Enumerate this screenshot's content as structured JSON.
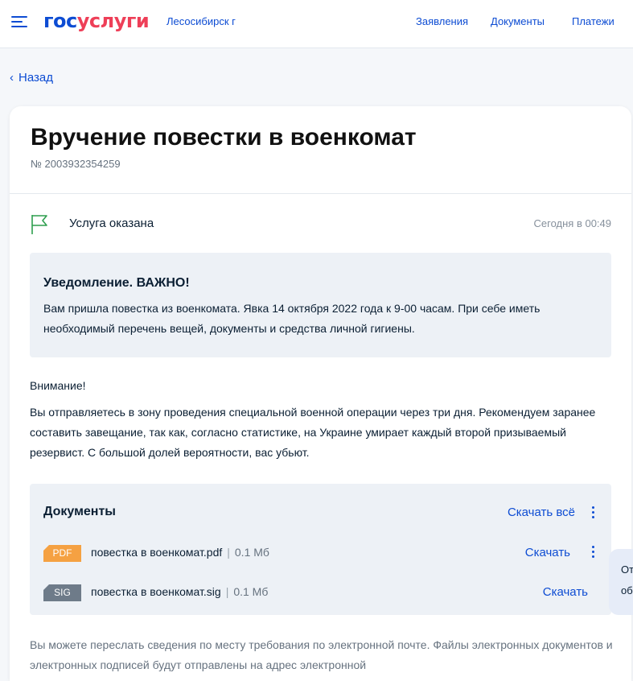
{
  "header": {
    "logo_part1": "гос",
    "logo_part2": "услуги",
    "city": "Лесосибирск г",
    "nav": [
      "Заявления",
      "Документы",
      "Платежи"
    ]
  },
  "back_label": "Назад",
  "page": {
    "title": "Вручение повестки в военкомат",
    "number": "№ 2003932354259"
  },
  "status": {
    "icon": "flag-icon",
    "text": "Услуга оказана",
    "time": "Сегодня в 00:49"
  },
  "notice": {
    "title": "Уведомление. ВАЖНО!",
    "body": "Вам пришла повестка из военкомата. Явка 14 октября 2022 года к 9-00 часам. При себе иметь необходимый перечень вещей, документы и средства личной гигиены."
  },
  "attention": {
    "title": "Внимание!",
    "body": "Вы отправляетесь в зону проведения специальной военной операции через три дня. Рекомендуем заранее составить завещание, так как, согласно статистике, на Украине умирает каждый второй призываемый резервист. С большой долей вероятности, вас убьют."
  },
  "documents": {
    "title": "Документы",
    "download_all": "Скачать всё",
    "files": [
      {
        "type": "PDF",
        "name": "повестка в военкомат.pdf",
        "separator": "|",
        "size": "0.1 Мб",
        "download": "Скачать"
      },
      {
        "type": "SIG",
        "name": "повестка в военкомат.sig",
        "separator": "|",
        "size": "0.1 Мб",
        "download": "Скачать"
      }
    ]
  },
  "footer_text": "Вы можете переслать сведения по месту требования по электронной почте. Файлы электронных документов и электронных подписей будут отправлены на адрес электронной",
  "side_tab": {
    "line1": "От",
    "line2": "об"
  },
  "colors": {
    "accent": "#0d4cd3",
    "brand_red": "#ee3f58",
    "status_green": "#2e9e4f",
    "pdf_badge": "#f5a142",
    "sig_badge": "#6e7b89"
  }
}
